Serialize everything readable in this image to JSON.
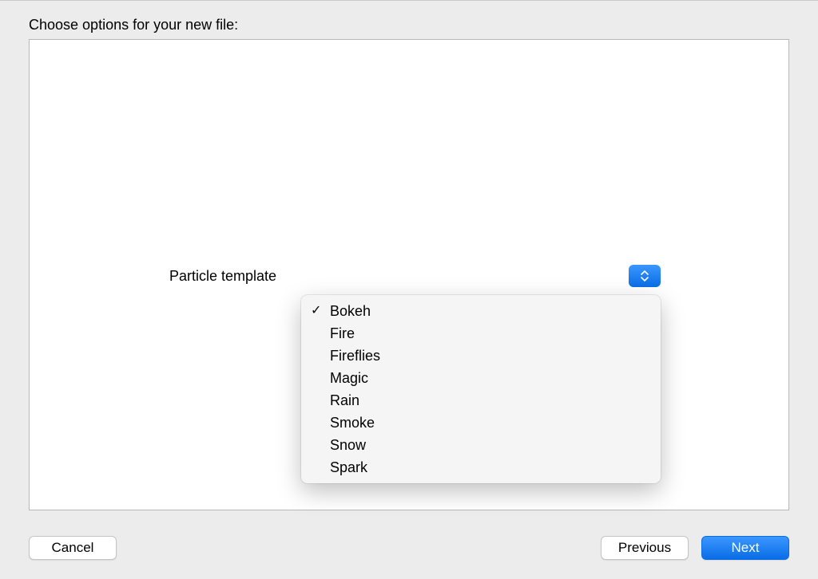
{
  "title": "Choose options for your new file:",
  "row_label": "Particle template",
  "dropdown": {
    "selected": "Bokeh",
    "items": [
      "Bokeh",
      "Fire",
      "Fireflies",
      "Magic",
      "Rain",
      "Smoke",
      "Snow",
      "Spark"
    ]
  },
  "buttons": {
    "cancel": "Cancel",
    "previous": "Previous",
    "next": "Next"
  },
  "colors": {
    "accent": "#1f82ff",
    "window_bg": "#ececec"
  }
}
